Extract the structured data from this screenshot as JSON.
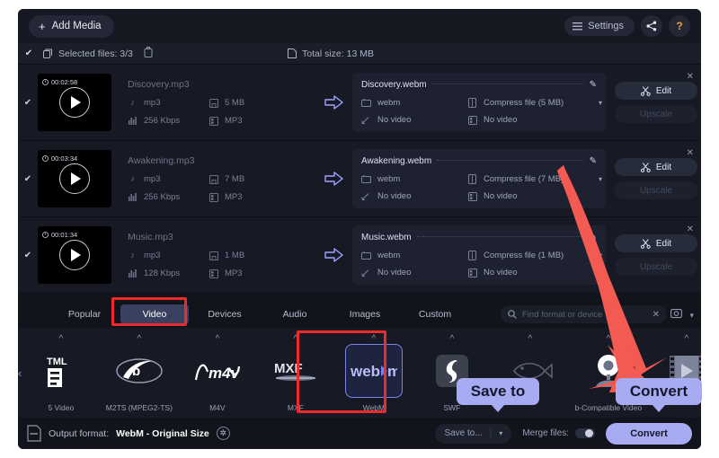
{
  "header": {
    "add_media_label": "Add Media",
    "add_icon": "plus-icon",
    "settings_label": "Settings",
    "settings_icon": "menu-lines-icon",
    "share_icon": "share-icon",
    "help_label": "?",
    "help_icon": "question-mark-icon"
  },
  "subbar": {
    "checkbox_icon": "checkmark-icon",
    "selected_files_label": "Selected files: 3/3",
    "files_icon": "files-icon",
    "trash_icon": "trash-icon",
    "total_size_label": "Total size: 13 MB",
    "page_icon": "document-icon"
  },
  "files": [
    {
      "duration": "00:02:58",
      "source_name": "Discovery.mp3",
      "source_format": "mp3",
      "source_size": "5 MB",
      "source_bitrate": "256 Kbps",
      "source_codec": "MP3",
      "output_name": "Discovery.webm",
      "output_format": "webm",
      "output_compress": "Compress file (5 MB)",
      "output_video": "No video",
      "output_video_codec": "No video",
      "edit_label": "Edit",
      "upscale_label": "Upscale"
    },
    {
      "duration": "00:03:34",
      "source_name": "Awakening.mp3",
      "source_format": "mp3",
      "source_size": "7 MB",
      "source_bitrate": "256 Kbps",
      "source_codec": "MP3",
      "output_name": "Awakening.webm",
      "output_format": "webm",
      "output_compress": "Compress file (7 MB)",
      "output_video": "No video",
      "output_video_codec": "No video",
      "edit_label": "Edit",
      "upscale_label": "Upscale"
    },
    {
      "duration": "00:01:34",
      "source_name": "Music.mp3",
      "source_format": "mp3",
      "source_size": "1 MB",
      "source_bitrate": "128 Kbps",
      "source_codec": "MP3",
      "output_name": "Music.webm",
      "output_format": "webm",
      "output_compress": "Compress file (1 MB)",
      "output_video": "No video",
      "output_video_codec": "No video",
      "edit_label": "Edit",
      "upscale_label": "Upscale"
    }
  ],
  "tabs": [
    {
      "label": "Popular",
      "active": false
    },
    {
      "label": "Video",
      "active": true
    },
    {
      "label": "Devices",
      "active": false
    },
    {
      "label": "Audio",
      "active": false
    },
    {
      "label": "Images",
      "active": false
    },
    {
      "label": "Custom",
      "active": false
    }
  ],
  "search": {
    "placeholder": "Find format or device",
    "value": "",
    "search_icon": "search-icon",
    "clear_icon": "close-icon",
    "device_icon": "device-preview-icon",
    "expand_icon": "chevron-down-icon"
  },
  "formats": {
    "prev_icon": "chevron-left-icon",
    "next_icon": "chevron-right-icon",
    "items": [
      {
        "label": "5 Video",
        "glyph": "HTML",
        "selected": false
      },
      {
        "label": "M2TS (MPEG2-TS)",
        "glyph": "bluray",
        "selected": false
      },
      {
        "label": "M4V",
        "glyph": "m4v",
        "selected": false
      },
      {
        "label": "MXF",
        "glyph": "MXF",
        "selected": false
      },
      {
        "label": "WebM",
        "glyph": "webm",
        "selected": true
      },
      {
        "label": "SWF",
        "glyph": "flash",
        "selected": false
      },
      {
        "label": "",
        "glyph": "fish",
        "selected": false
      },
      {
        "label": "b-Compatible Video",
        "glyph": "webcam",
        "selected": false
      },
      {
        "label": "",
        "glyph": "film",
        "selected": false
      }
    ]
  },
  "bottom": {
    "output_format_label": "Output format:",
    "output_format_value": "WebM - Original Size",
    "gear_icon": "gear-icon",
    "file_icon": "output-file-icon",
    "save_to_label": "Save to...",
    "save_to_caret": "chevron-down-icon",
    "merge_files_label": "Merge files:",
    "convert_label": "Convert"
  },
  "annotations": {
    "callout_save_to": "Save to",
    "callout_convert": "Convert",
    "highlight_color": "#ee2b2b",
    "callout_color": "#a7abf2",
    "arrow_color": "#f25a52"
  }
}
